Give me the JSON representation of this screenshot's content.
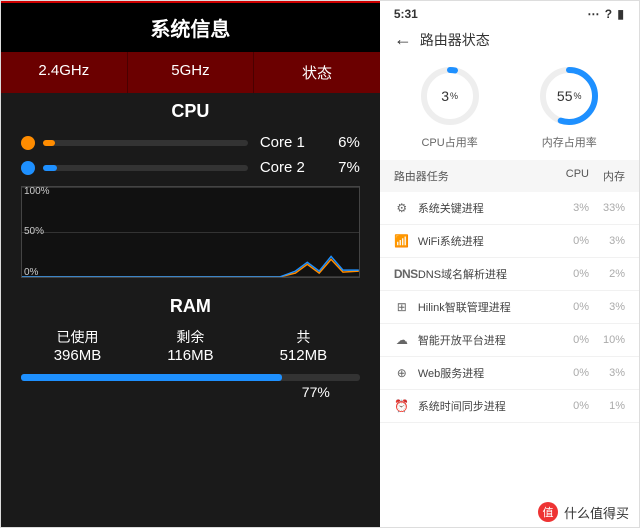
{
  "left": {
    "title": "系统信息",
    "tabs": [
      "2.4GHz",
      "5GHz",
      "状态"
    ],
    "cpu": {
      "heading": "CPU",
      "cores": [
        {
          "label": "Core 1",
          "pct": 6,
          "color": "#ff8c00"
        },
        {
          "label": "Core 2",
          "pct": 7,
          "color": "#1e90ff"
        }
      ],
      "graph_y": [
        "100%",
        "50%",
        "0%"
      ]
    },
    "ram": {
      "heading": "RAM",
      "cols": [
        {
          "label": "已使用",
          "value": "396MB"
        },
        {
          "label": "剩余",
          "value": "116MB"
        },
        {
          "label": "共",
          "value": "512MB"
        }
      ],
      "pct": 77
    }
  },
  "right": {
    "status_time": "5:31",
    "title": "路由器状态",
    "gauges": [
      {
        "value": 3,
        "unit": "%",
        "label": "CPU占用率",
        "color": "#1e90ff"
      },
      {
        "value": 55,
        "unit": "%",
        "label": "内存占用率",
        "color": "#1e90ff"
      }
    ],
    "table_head": {
      "c1": "路由器任务",
      "c2": "CPU",
      "c3": "内存"
    },
    "tasks": [
      {
        "icon": "gear-icon",
        "glyph": "⚙",
        "name": "系统关键进程",
        "cpu": "3%",
        "mem": "33%"
      },
      {
        "icon": "wifi-icon",
        "glyph": "📶",
        "name": "WiFi系统进程",
        "cpu": "0%",
        "mem": "3%"
      },
      {
        "icon": "dns-icon",
        "glyph": "DNS",
        "name": "DNS域名解析进程",
        "cpu": "0%",
        "mem": "2%"
      },
      {
        "icon": "link-icon",
        "glyph": "⊞",
        "name": "Hilink智联管理进程",
        "cpu": "0%",
        "mem": "3%"
      },
      {
        "icon": "cloud-icon",
        "glyph": "☁",
        "name": "智能开放平台进程",
        "cpu": "0%",
        "mem": "10%"
      },
      {
        "icon": "globe-icon",
        "glyph": "⊕",
        "name": "Web服务进程",
        "cpu": "0%",
        "mem": "3%"
      },
      {
        "icon": "clock-icon",
        "glyph": "⏰",
        "name": "系统时间同步进程",
        "cpu": "0%",
        "mem": "1%"
      }
    ]
  },
  "watermark": {
    "badge": "值",
    "text": "什么值得买"
  },
  "chart_data": {
    "type": "line",
    "title": "CPU usage over time",
    "ylabel": "%",
    "ylim": [
      0,
      100
    ],
    "series": [
      {
        "name": "Core 1",
        "color": "#ff8c00",
        "values": [
          0,
          0,
          0,
          0,
          0,
          0,
          0,
          0,
          0,
          0,
          0,
          0,
          0,
          0,
          0,
          3,
          12,
          4,
          18,
          6
        ]
      },
      {
        "name": "Core 2",
        "color": "#1e90ff",
        "values": [
          0,
          0,
          0,
          0,
          0,
          0,
          0,
          0,
          0,
          0,
          0,
          0,
          0,
          0,
          0,
          5,
          15,
          6,
          22,
          7
        ]
      }
    ]
  }
}
